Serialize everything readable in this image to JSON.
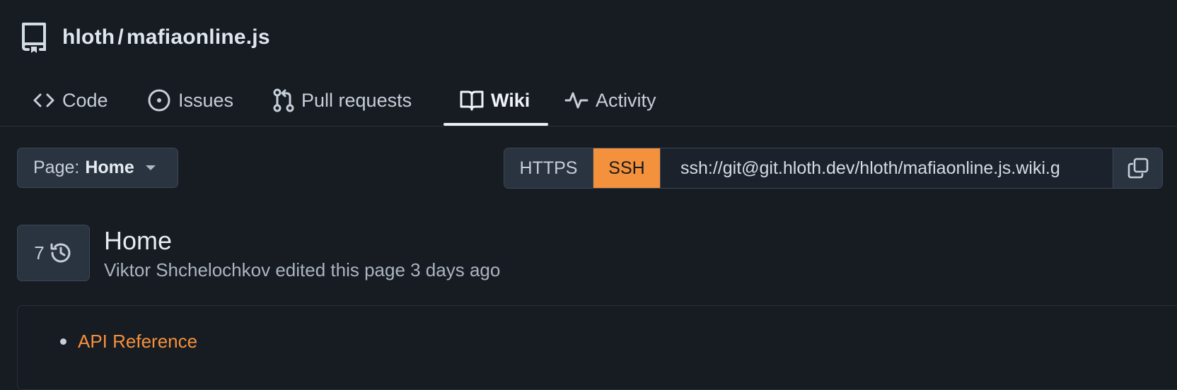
{
  "repo": {
    "owner": "hloth",
    "separator": "/",
    "name": "mafiaonline.js"
  },
  "tabs": [
    {
      "label": "Code",
      "icon": "code-icon"
    },
    {
      "label": "Issues",
      "icon": "issue-opened-icon"
    },
    {
      "label": "Pull requests",
      "icon": "git-pull-request-icon"
    },
    {
      "label": "Wiki",
      "icon": "book-icon",
      "active": true
    },
    {
      "label": "Activity",
      "icon": "pulse-icon"
    }
  ],
  "page_select": {
    "prefix": "Page:",
    "value": "Home"
  },
  "clone": {
    "https_label": "HTTPS",
    "ssh_label": "SSH",
    "selected": "SSH",
    "url": "ssh://git@git.hloth.dev/hloth/mafiaonline.js.wiki.g",
    "accent": "#f4913c"
  },
  "page": {
    "revision_count": "7",
    "title": "Home",
    "meta": "Viktor Shchelochkov edited this page 3 days ago"
  },
  "content": {
    "items": [
      {
        "label": "API Reference"
      }
    ]
  }
}
